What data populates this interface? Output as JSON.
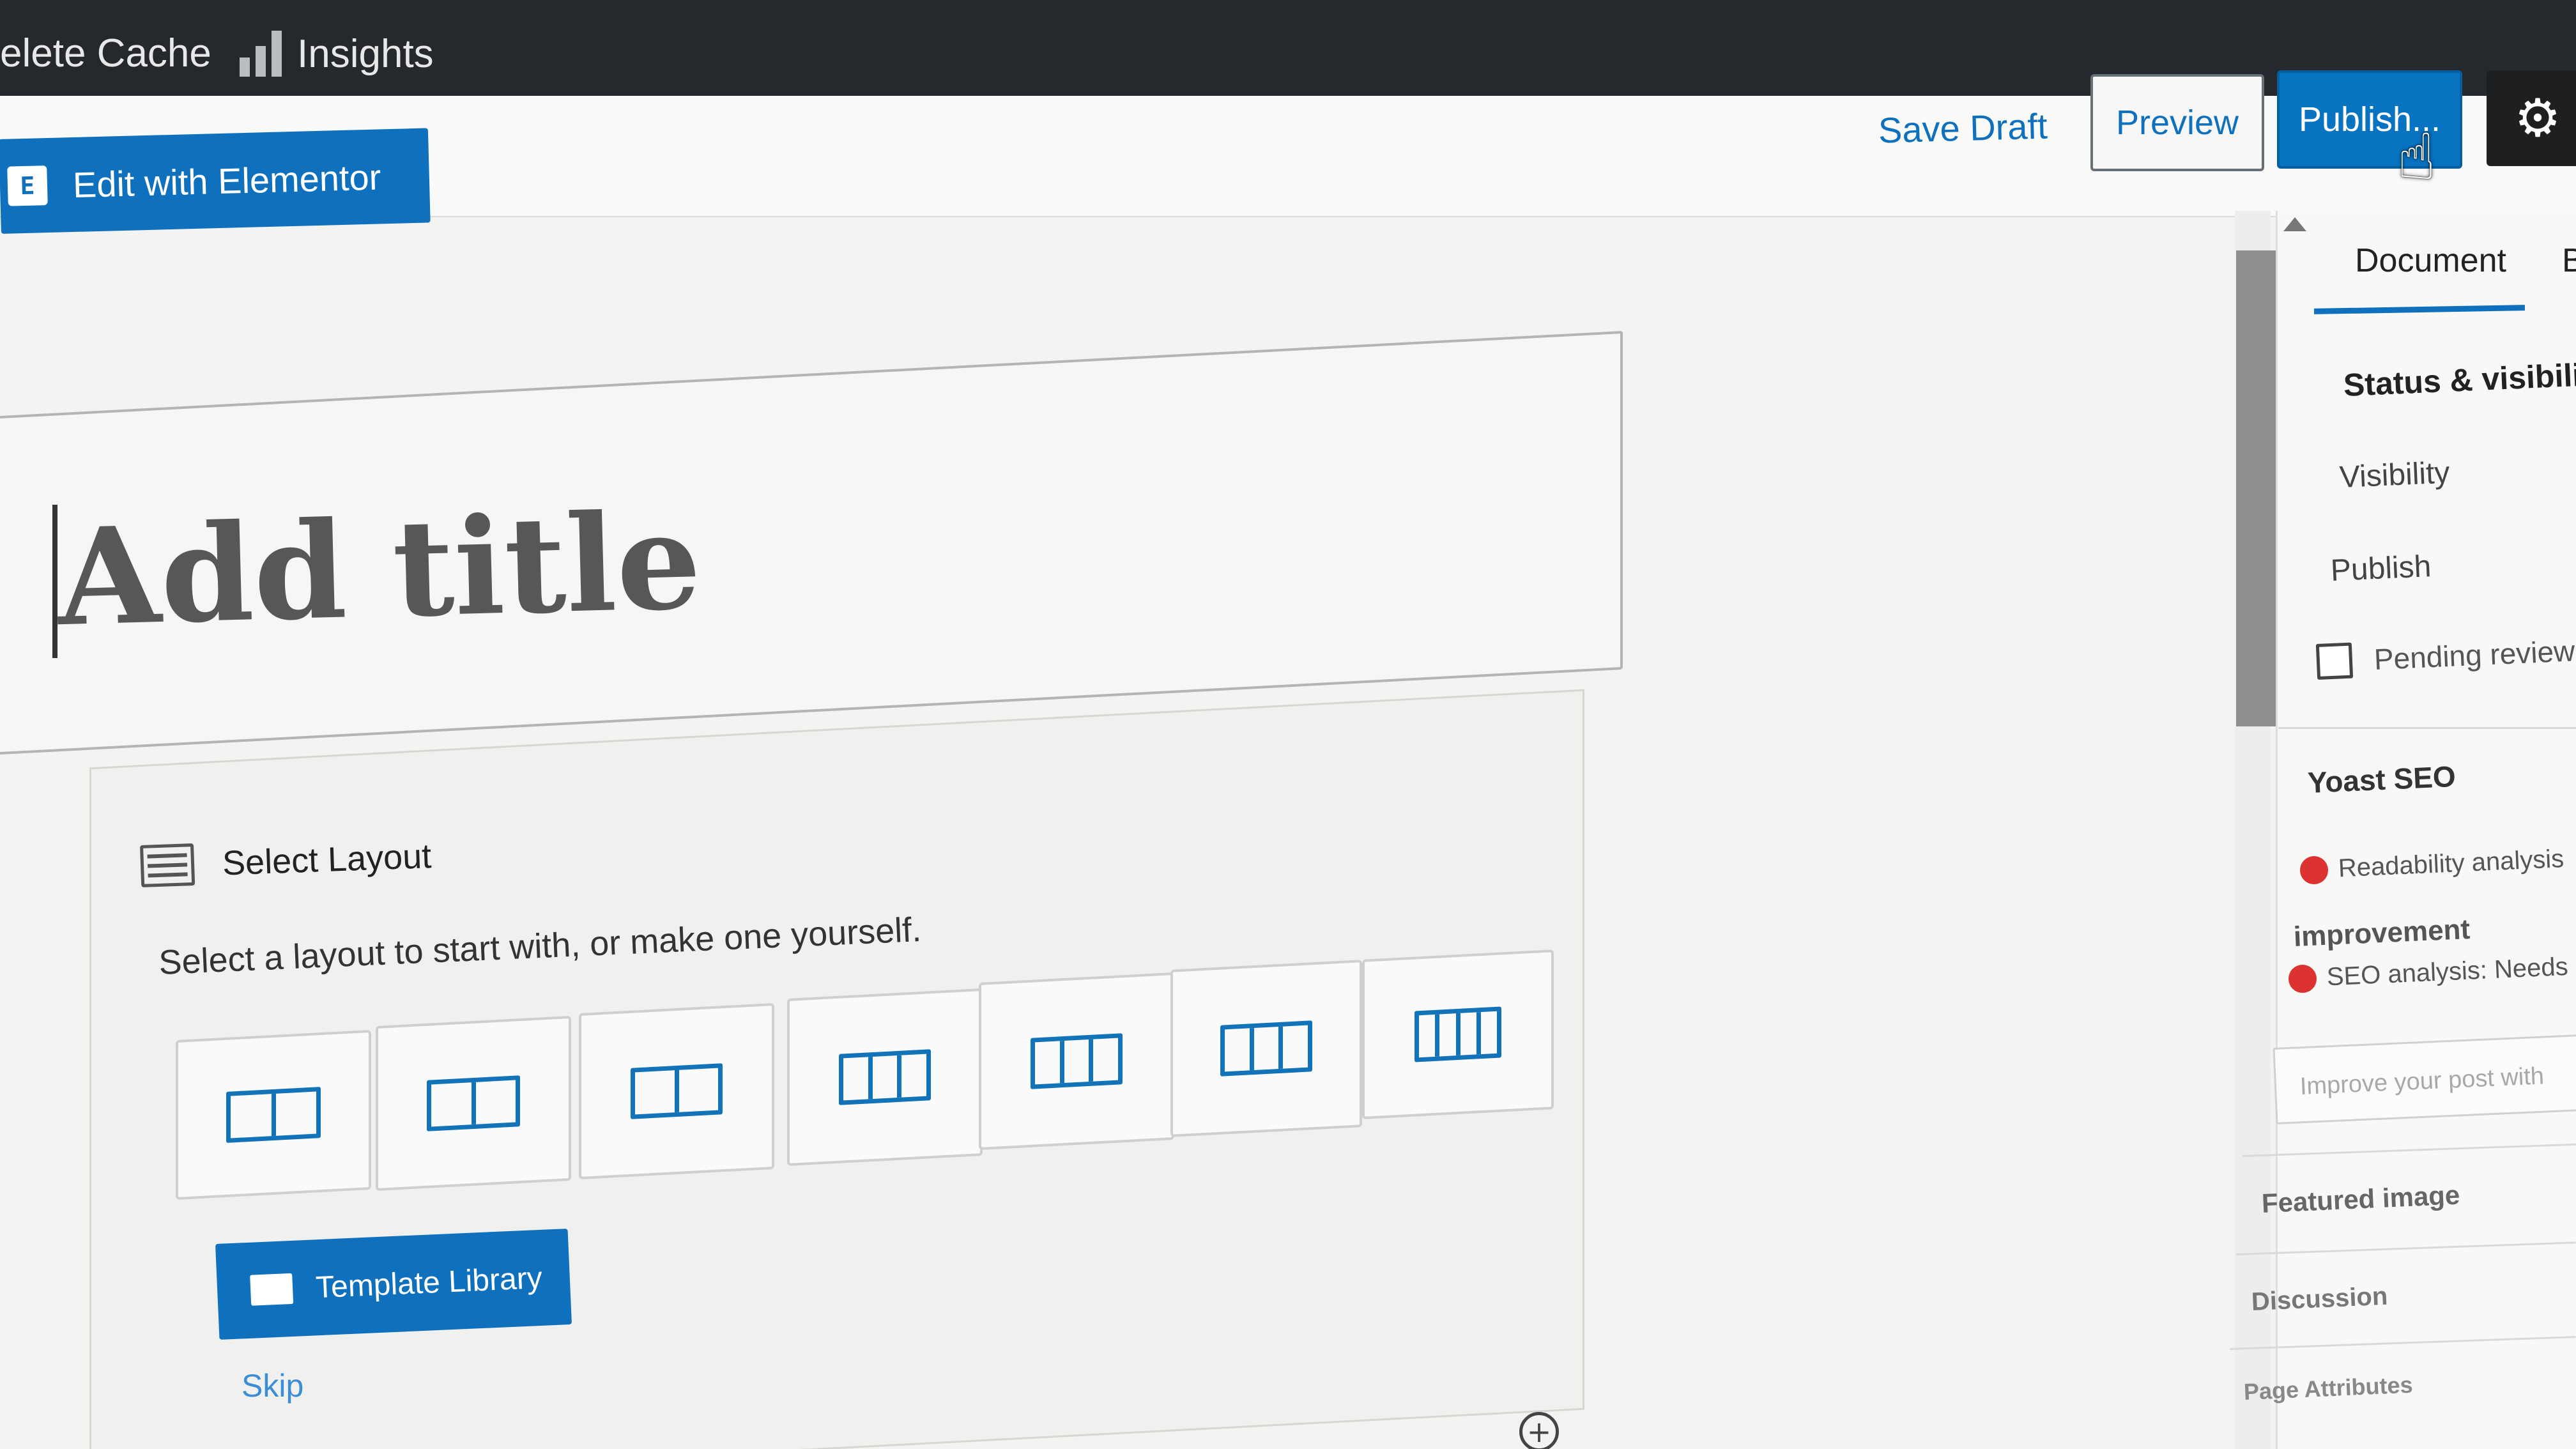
{
  "admin_bar": {
    "delete_cache_label": "elete Cache",
    "insights_label": "Insights",
    "insights_icon": "bar-chart-icon",
    "background": "#25282c"
  },
  "header": {
    "elementor_label": "Edit with Elementor",
    "elementor_icon_glyph": "E",
    "save_draft_label": "Save Draft",
    "preview_label": "Preview",
    "publish_label": "Publish...",
    "settings_icon": "gear-icon",
    "accent_color": "#0f71bd"
  },
  "editor": {
    "title_placeholder": "Add title"
  },
  "layout_selector": {
    "title": "Select Layout",
    "description": "Select a layout to start with, or make one yourself.",
    "template_library_label": "Template Library",
    "skip_label": "Skip",
    "layouts": [
      {
        "columns": 2
      },
      {
        "columns": 2
      },
      {
        "columns": 2
      },
      {
        "columns": 3
      },
      {
        "columns": 3
      },
      {
        "columns": 3
      },
      {
        "columns": 4
      }
    ]
  },
  "sidebar": {
    "tab_document": "Document",
    "tab_block_partial": "B",
    "status_visibility_heading": "Status & visibility",
    "visibility_label": "Visibility",
    "publish_label": "Publish",
    "pending_review_label": "Pending review",
    "pending_review_checked": false,
    "yoast_heading": "Yoast SEO",
    "readability_text": "Readability analysis",
    "improvement_text": "improvement",
    "seo_analysis_text": "SEO analysis: Needs",
    "improve_post_text": "Improve your post with",
    "featured_image_label": "Featured image",
    "discussion_label": "Discussion",
    "page_attributes_label": "Page Attributes",
    "status_dot_color": "#dc3232"
  }
}
